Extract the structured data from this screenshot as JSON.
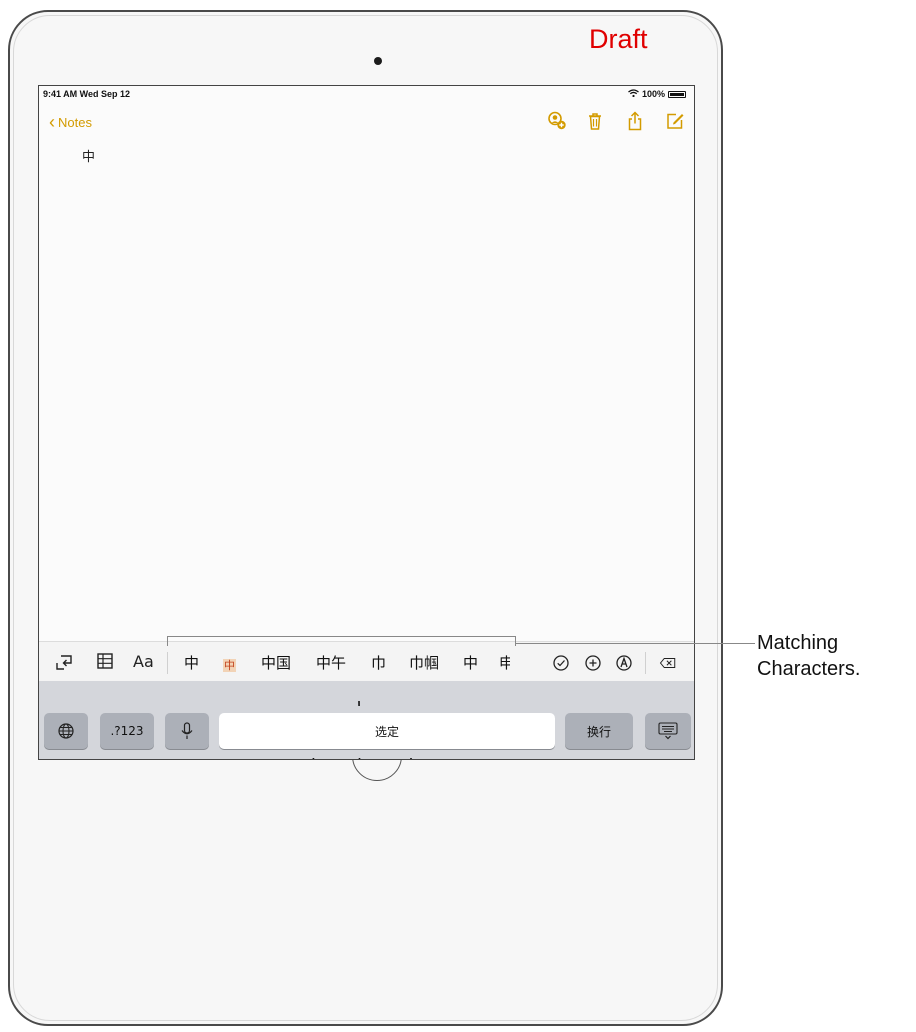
{
  "watermark": "Draft",
  "status_bar": {
    "time": "9:41 AM  Wed Sep 12",
    "battery": "100%"
  },
  "nav": {
    "back_label": "Notes",
    "tools": [
      "add-person-icon",
      "trash-icon",
      "share-icon",
      "compose-icon"
    ]
  },
  "note": {
    "content": "中"
  },
  "keyboard_toolbar": {
    "left_tools": [
      "undo-icon",
      "table-icon"
    ],
    "format_label": "Aa",
    "candidates": [
      "中",
      "中",
      "中国",
      "中午",
      "巾",
      "巾帼",
      "中",
      "申"
    ],
    "right_tools": [
      "checklist-icon",
      "insert-icon",
      "markup-icon"
    ],
    "delete_icon": "delete-icon"
  },
  "keyboard": {
    "globe_icon": "globe-icon",
    "numbers_label": ".?123",
    "mic_icon": "microphone-icon",
    "space_label": "选定",
    "return_label": "换行",
    "dismiss_icon": "keyboard-dismiss-icon"
  },
  "callout": {
    "line1": "Matching",
    "line2": "Characters."
  },
  "colors": {
    "accent": "#d39b00",
    "watermark": "#e00000",
    "keyboard_bg": "#d4d6db"
  }
}
